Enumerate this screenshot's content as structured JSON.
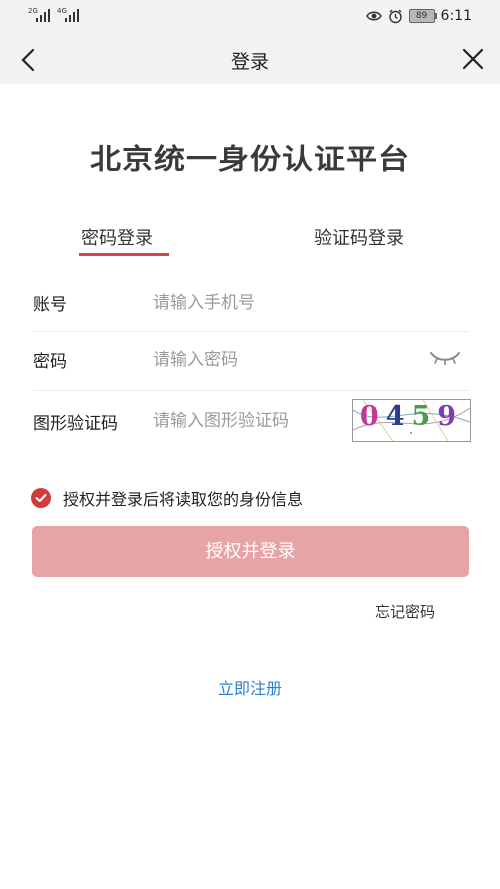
{
  "status_bar": {
    "signal_1_label": "2G",
    "signal_2_label": "4G",
    "battery": "89",
    "time": "6:11",
    "icons": [
      "signal-icon",
      "signal-icon",
      "eye-icon",
      "alarm-icon",
      "battery-icon"
    ]
  },
  "nav": {
    "title": "登录",
    "back_icon": "chevron-left-icon",
    "close_icon": "close-icon"
  },
  "platform_title": "北京统一身份认证平台",
  "tabs": [
    {
      "label": "密码登录",
      "active": true
    },
    {
      "label": "验证码登录",
      "active": false
    }
  ],
  "form": {
    "account": {
      "label": "账号",
      "placeholder": "请输入手机号"
    },
    "password": {
      "label": "密码",
      "placeholder": "请输入密码"
    },
    "captcha": {
      "label": "图形验证码",
      "placeholder": "请输入图形验证码",
      "image_text": "0459"
    }
  },
  "agreement": {
    "checked": true,
    "text": "授权并登录后将读取您的身份信息"
  },
  "submit_label": "授权并登录",
  "forgot_label": "忘记密码",
  "register_label": "立即注册",
  "colors": {
    "accent": "#d9434a",
    "submit_bg": "#e7a4a6",
    "link_blue": "#2f7fd4",
    "bar_bg": "#f2f2f2"
  }
}
